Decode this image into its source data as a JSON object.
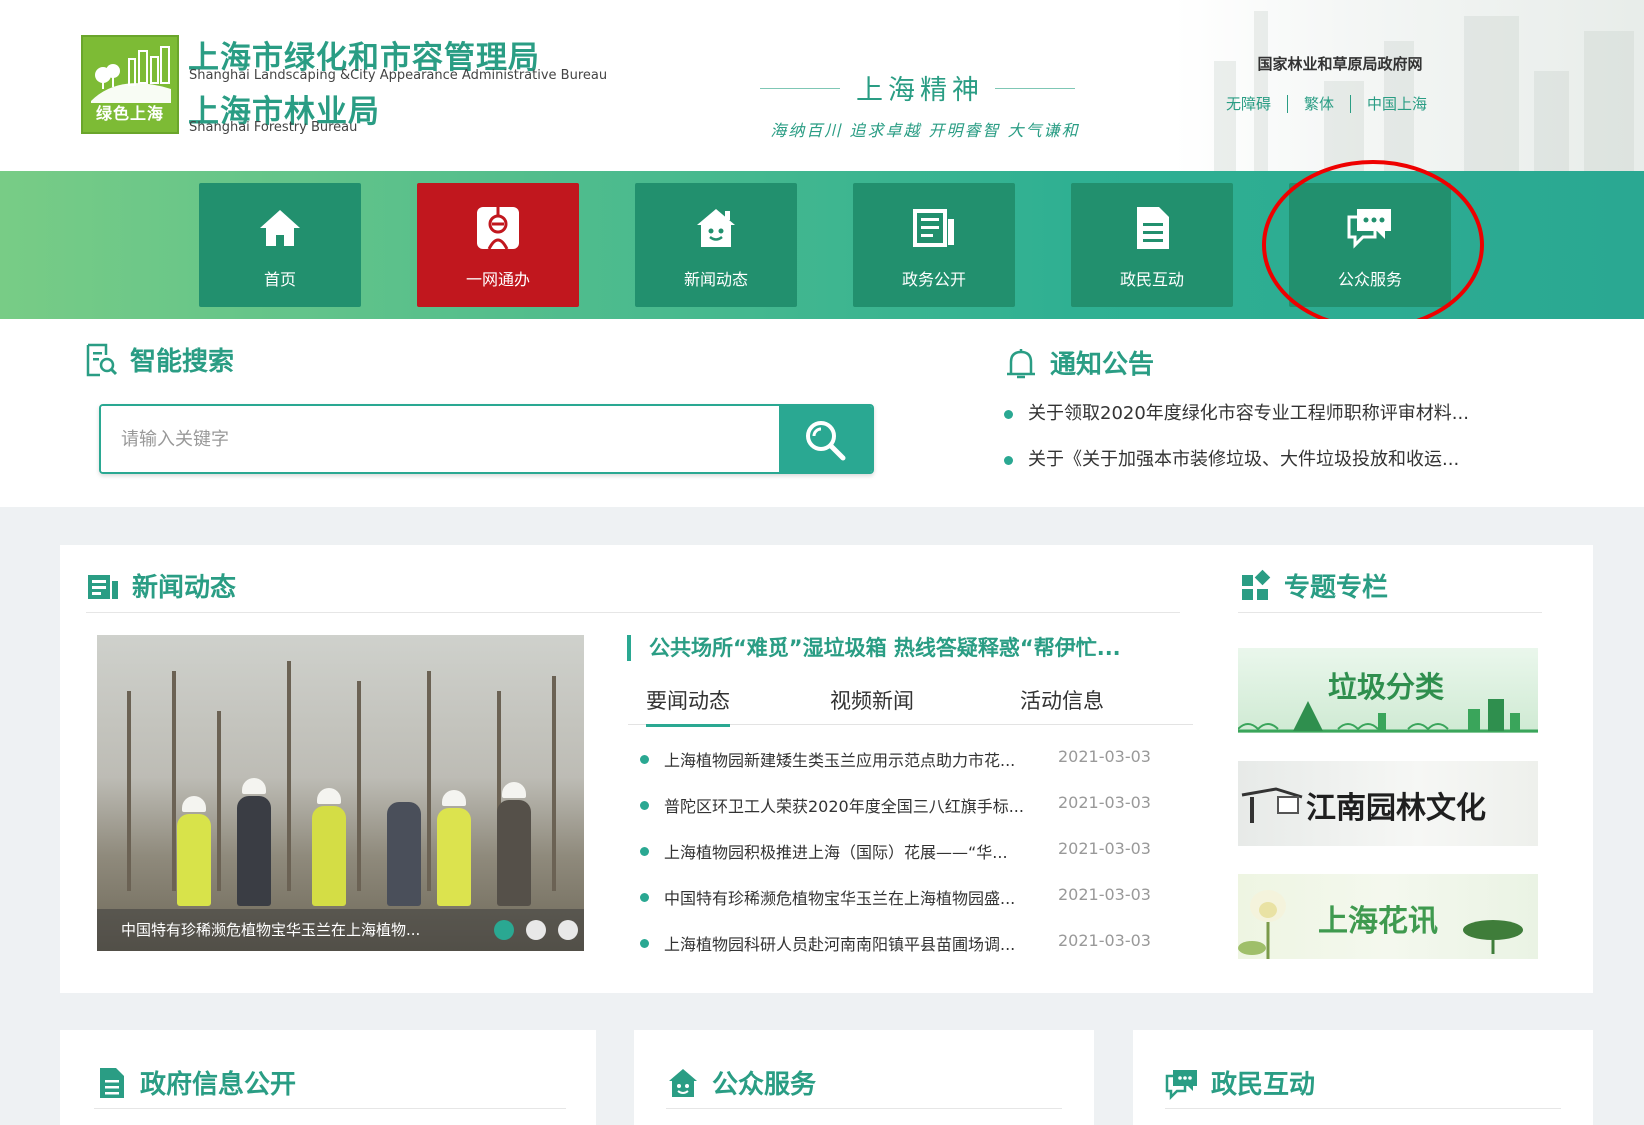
{
  "header": {
    "logo_text": "绿色上海",
    "org_name_cn_1": "上海市绿化和市容管理局",
    "org_name_en_1": "Shanghai Landscaping &City Appearance Administrative Bureau",
    "org_name_cn_2": "上海市林业局",
    "org_name_en_2": "Shanghai Forestry Bureau",
    "spirit_title": "上海精神",
    "spirit_motto": "海纳百川 追求卓越 开明睿智 大气谦和",
    "gov_link": "国家林业和草原局政府网",
    "top_links": [
      "无障碍",
      "繁体",
      "中国上海"
    ]
  },
  "nav": {
    "items": [
      {
        "label": "首页",
        "icon": "home-icon"
      },
      {
        "label": "一网通办",
        "icon": "one-network-icon"
      },
      {
        "label": "新闻动态",
        "icon": "news-house-icon"
      },
      {
        "label": "政务公开",
        "icon": "document-list-icon"
      },
      {
        "label": "政民互动",
        "icon": "file-icon"
      },
      {
        "label": "公众服务",
        "icon": "chat-bubble-icon"
      }
    ],
    "active_index": 1,
    "highlighted_index": 5
  },
  "search": {
    "title": "智能搜索",
    "placeholder": "请输入关键字"
  },
  "notice": {
    "title": "通知公告",
    "items": [
      "关于领取2020年度绿化市容专业工程师职称评审材料...",
      "关于《关于加强本市装修垃圾、大件垃圾投放和收运..."
    ]
  },
  "news": {
    "title": "新闻动态",
    "photo_caption": "中国特有珍稀濒危植物宝华玉兰在上海植物...",
    "headline": "公共场所“难觅”湿垃圾箱 热线答疑释惑“帮伊忙...",
    "tabs": [
      "要闻动态",
      "视频新闻",
      "活动信息"
    ],
    "active_tab": 0,
    "items": [
      {
        "title": "上海植物园新建矮生类玉兰应用示范点助力市花...",
        "date": "2021-03-03"
      },
      {
        "title": "普陀区环卫工人荣获2020年度全国三八红旗手标...",
        "date": "2021-03-03"
      },
      {
        "title": "上海植物园积极推进上海（国际）花展——“华...",
        "date": "2021-03-03"
      },
      {
        "title": "中国特有珍稀濒危植物宝华玉兰在上海植物园盛...",
        "date": "2021-03-03"
      },
      {
        "title": "上海植物园科研人员赴河南南阳镇平县苗圃场调...",
        "date": "2021-03-03"
      }
    ]
  },
  "topics": {
    "title": "专题专栏",
    "banners": [
      "垃圾分类",
      "江南园林文化",
      "上海花讯"
    ]
  },
  "bottom_sections": {
    "gov_info": "政府信息公开",
    "public_service": "公众服务",
    "interaction": "政民互动"
  },
  "colors": {
    "brand_green": "#2a9d84",
    "nav_tile": "#22906e",
    "nav_active": "#c1171e",
    "highlight_ring": "#e00000"
  }
}
